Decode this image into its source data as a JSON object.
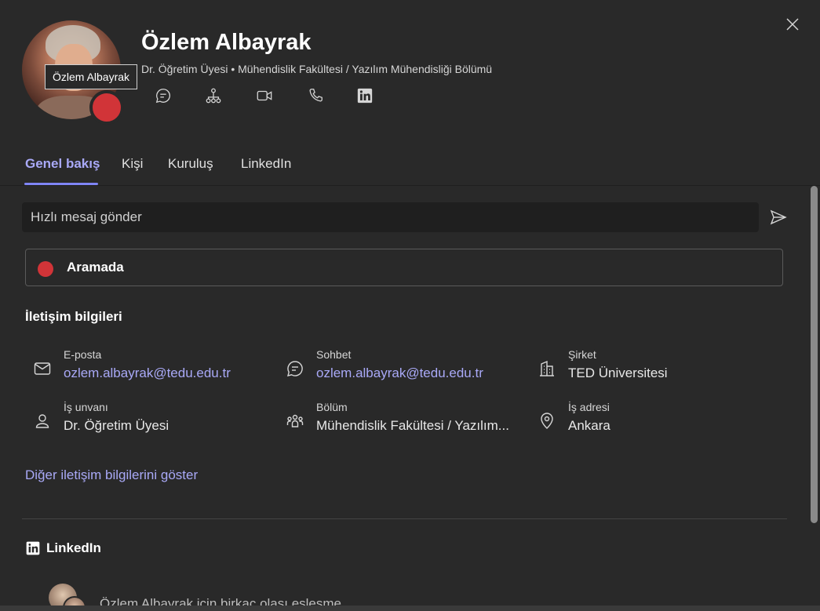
{
  "profile": {
    "name": "Özlem Albayrak",
    "subtitle": "Dr. Öğretim Üyesi • Mühendislik Fakültesi / Yazılım Mühendisliği Bölümü",
    "tooltip": "Özlem Albayrak",
    "presence_color": "#d13438"
  },
  "actions": [
    {
      "icon": "chat-icon"
    },
    {
      "icon": "org-chart-icon"
    },
    {
      "icon": "video-call-icon"
    },
    {
      "icon": "phone-icon"
    },
    {
      "icon": "linkedin-icon"
    }
  ],
  "tabs": [
    {
      "label": "Genel bakış",
      "active": true
    },
    {
      "label": "Kişi",
      "active": false
    },
    {
      "label": "Kuruluş",
      "active": false
    },
    {
      "label": "LinkedIn",
      "active": false
    }
  ],
  "quick_message": {
    "placeholder": "Hızlı mesaj gönder"
  },
  "status": {
    "label": "Aramada",
    "color": "#d13438"
  },
  "contact": {
    "title": "İletişim bilgileri",
    "items": [
      {
        "label": "E-posta",
        "value": "ozlem.albayrak@tedu.edu.tr",
        "icon": "mail-icon"
      },
      {
        "label": "Sohbet",
        "value": "ozlem.albayrak@tedu.edu.tr",
        "icon": "chat-icon"
      },
      {
        "label": "Şirket",
        "value": "TED Üniversitesi",
        "icon": "building-icon"
      },
      {
        "label": "İş unvanı",
        "value": "Dr. Öğretim Üyesi",
        "icon": "person-icon"
      },
      {
        "label": "Bölüm",
        "value": "Mühendislik Fakültesi / Yazılım...",
        "icon": "people-icon"
      },
      {
        "label": "İş adresi",
        "value": "Ankara",
        "icon": "location-icon"
      }
    ],
    "more_link": "Diğer iletişim bilgilerini göster"
  },
  "linkedin": {
    "title": "LinkedIn",
    "match_text": "Özlem Albayrak için birkaç olası eşleşme"
  },
  "colors": {
    "accent": "#a9a9f7",
    "background": "#292929",
    "input_bg": "#1f1f1f"
  }
}
